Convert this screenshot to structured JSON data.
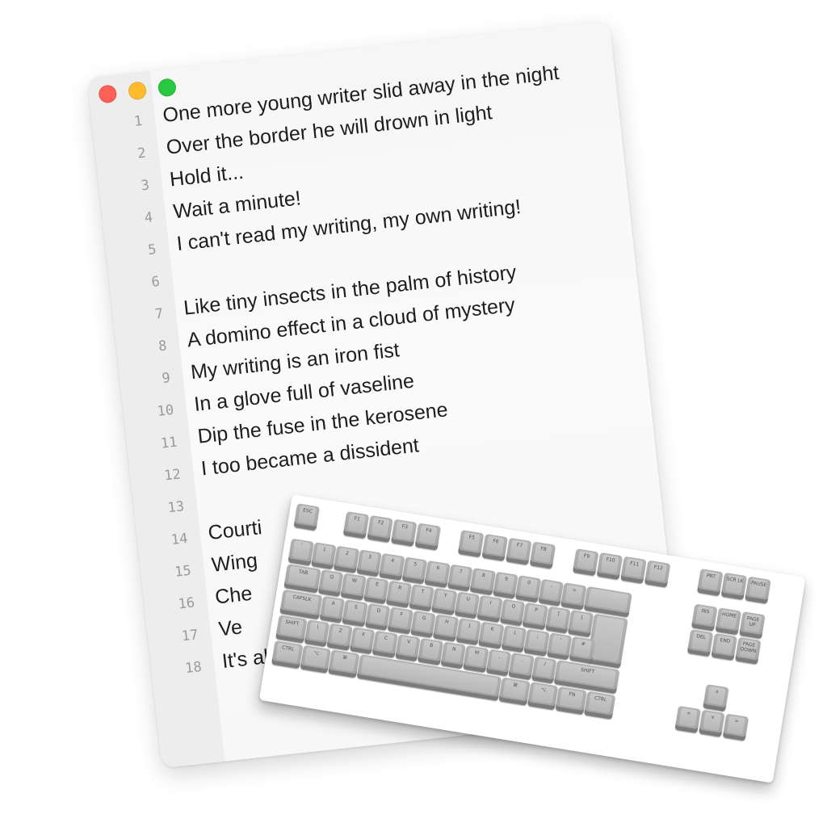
{
  "editor": {
    "window_controls": {
      "close": "close",
      "minimize": "minimize",
      "zoom": "zoom"
    },
    "lines": [
      {
        "number": "1",
        "text": "One more young writer slid away in the night"
      },
      {
        "number": "2",
        "text": "Over the border he will drown in light"
      },
      {
        "number": "3",
        "text": "Hold it..."
      },
      {
        "number": "4",
        "text": "Wait a minute!"
      },
      {
        "number": "5",
        "text": "I can't read my writing, my own writing!"
      },
      {
        "number": "6",
        "text": ""
      },
      {
        "number": "7",
        "text": "Like tiny insects in the palm of history"
      },
      {
        "number": "8",
        "text": "A domino effect in a cloud of mystery"
      },
      {
        "number": "9",
        "text": "My writing is an iron fist"
      },
      {
        "number": "10",
        "text": "In a glove full of vaseline"
      },
      {
        "number": "11",
        "text": "Dip the fuse in the kerosene"
      },
      {
        "number": "12",
        "text": "I too became a dissident"
      },
      {
        "number": "13",
        "text": ""
      },
      {
        "number": "14",
        "text": "Courti"
      },
      {
        "number": "15",
        "text": "Wing"
      },
      {
        "number": "16",
        "text": "Che"
      },
      {
        "number": "17",
        "text": "Ve"
      },
      {
        "number": "18",
        "text": "It's all here in"
      }
    ]
  },
  "keyboard": {
    "row_function": [
      "ESC",
      "F1",
      "F2",
      "F3",
      "F4",
      "F5",
      "F6",
      "F7",
      "F8",
      "F9",
      "F10",
      "F11",
      "F12",
      "PRT",
      "SCR LK",
      "PAUSE"
    ],
    "row_number": [
      "`",
      "1",
      "2",
      "3",
      "4",
      "5",
      "6",
      "7",
      "8",
      "9",
      "0",
      "-",
      "=",
      "",
      "INS",
      "HOME",
      "PAGE UP"
    ],
    "row_qwerty": [
      "TAB",
      "Q",
      "W",
      "E",
      "R",
      "T",
      "Y",
      "U",
      "I",
      "O",
      "P",
      "[",
      "]",
      "",
      "DEL",
      "END",
      "PAGE DOWN"
    ],
    "row_home": [
      "CAPSLK",
      "A",
      "S",
      "D",
      "F",
      "G",
      "H",
      "J",
      "K",
      "L",
      ";",
      "'",
      "#"
    ],
    "row_shift": [
      "SHIFT",
      "\\",
      "Z",
      "X",
      "C",
      "V",
      "B",
      "N",
      "M",
      ",",
      ".",
      "/",
      "SHIFT"
    ],
    "row_bottom": [
      "CTRL",
      "⌥",
      "⌘",
      "",
      "⌘",
      "⌥",
      "FN",
      "CTRL"
    ],
    "arrows": [
      "∧",
      "<",
      "∨",
      ">"
    ]
  }
}
